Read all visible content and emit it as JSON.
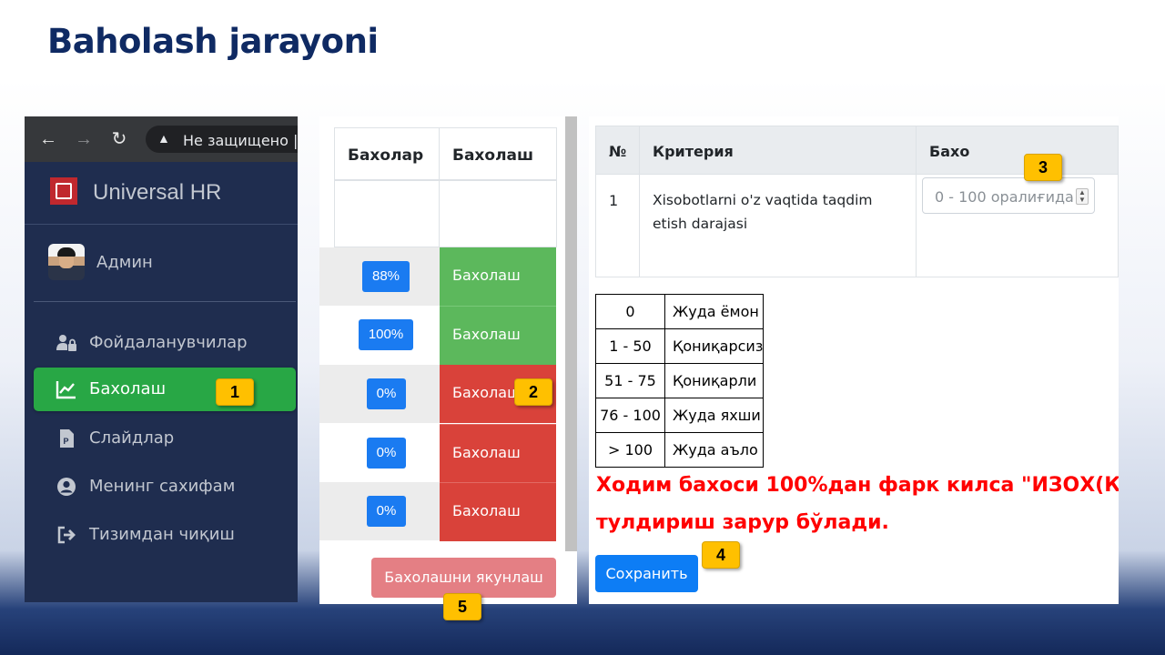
{
  "slide": {
    "title": "Baholash jarayoni"
  },
  "panel1": {
    "browser": {
      "url_text": "Не защищено  |"
    },
    "brand": "Universal HR",
    "user": "Админ",
    "menu": [
      {
        "label": "Фойдаланувчилар",
        "icon": "users-lock-icon"
      },
      {
        "label": "Бахолаш",
        "icon": "chart-line-icon",
        "active": true
      },
      {
        "label": "Слайдлар",
        "icon": "powerpoint-file-icon"
      },
      {
        "label": "Менинг сахифам",
        "icon": "user-circle-icon"
      },
      {
        "label": "Тизимдан чиқиш",
        "icon": "sign-out-icon"
      }
    ]
  },
  "panel2": {
    "headers": [
      "Бахолар",
      "Бахолаш"
    ],
    "rows": [
      {
        "percent": "88%",
        "action": "Бахолаш",
        "status": "done"
      },
      {
        "percent": "100%",
        "action": "Бахолаш",
        "status": "done"
      },
      {
        "percent": "0%",
        "action": "Бахолаш",
        "status": "pending"
      },
      {
        "percent": "0%",
        "action": "Бахолаш",
        "status": "pending"
      },
      {
        "percent": "0%",
        "action": "Бахолаш",
        "status": "pending"
      }
    ],
    "finish_button": "Бахолашни якунлаш"
  },
  "panel3": {
    "headers": [
      "№",
      "Критерия",
      "Бахо"
    ],
    "row": {
      "num": "1",
      "criteria_line1": "Xisobotlarni o'z vaqtida taqdim",
      "criteria_line2": "etish darajasi",
      "input_placeholder": "0 - 100 оралиғида"
    },
    "legend": [
      {
        "range": "0",
        "label": "Жуда ёмон"
      },
      {
        "range": "1 - 50",
        "label": "Қониқарсиз"
      },
      {
        "range": "51 - 75",
        "label": "Қониқарли"
      },
      {
        "range": "76 - 100",
        "label": "Жуда яхши"
      },
      {
        "range": "> 100",
        "label": "Жуда аъло"
      }
    ],
    "warning_line1": "Ходим бахоси 100%дан фарк килса \"ИЗОХ(К",
    "warning_line2": "тулдириш зарур бўлади.",
    "save_button": "Сохранить"
  },
  "badges": [
    "1",
    "2",
    "3",
    "4",
    "5"
  ],
  "colors": {
    "title": "#0f2a63",
    "sidebar_bg": "#1f2d4f",
    "active_menu": "#28a745",
    "done": "#5cb85c",
    "pending": "#d9423a",
    "percent_badge": "#1a7bf1",
    "finish_disabled": "#e47f84",
    "save": "#0d7df5",
    "warning_text": "#ff0000",
    "callout_badge": "#ffc000"
  }
}
